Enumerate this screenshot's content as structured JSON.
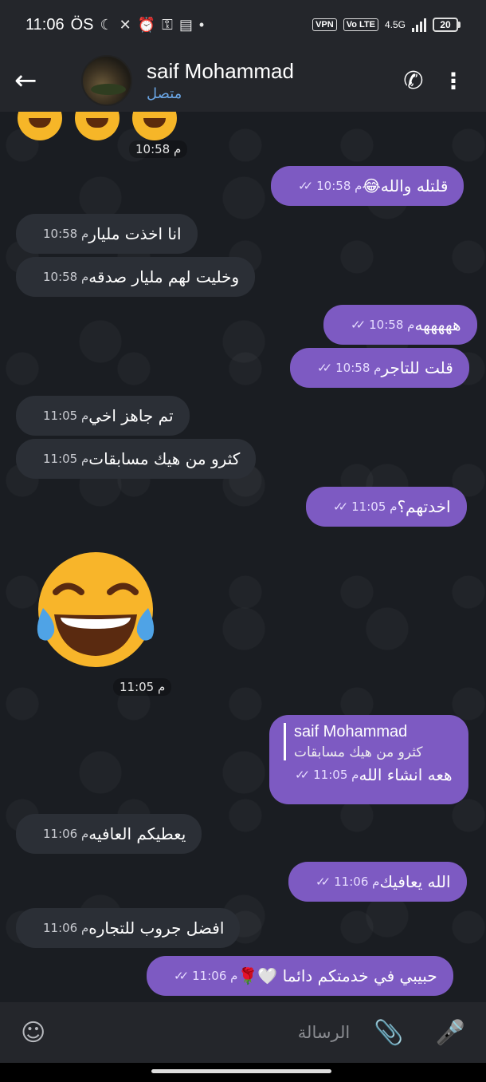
{
  "status": {
    "time": "11:06",
    "carrier": "ÖS",
    "vpn": "VPN",
    "volte": "Vo LTE",
    "network": "4.5G",
    "battery": "20"
  },
  "header": {
    "contact_name": "saif Mohammad",
    "contact_status": "متصل",
    "icons": {
      "back": "arrow-left-icon",
      "call": "phone-icon",
      "menu": "more-vertical-icon"
    }
  },
  "messages": [
    {
      "dir": "time-only",
      "time": "10:58 م"
    },
    {
      "dir": "out",
      "text": "قلتله والله😂",
      "time": "10:58 م"
    },
    {
      "dir": "in",
      "text": "انا اخذت مليار",
      "time": "10:58 م"
    },
    {
      "dir": "in",
      "text": "وخليت لهم مليار صدقه",
      "time": "10:58 م"
    },
    {
      "dir": "out",
      "text": "هههههه",
      "time": "10:58 م"
    },
    {
      "dir": "out",
      "text": "قلت للتاجر",
      "time": "10:58 م"
    },
    {
      "dir": "in",
      "text": "تم جاهز اخي",
      "time": "11:05 م"
    },
    {
      "dir": "in",
      "text": "كثرو من هيك مسابقات",
      "time": "11:05 م"
    },
    {
      "dir": "out",
      "text": "اخدتهم؟",
      "time": "11:05 م"
    },
    {
      "dir": "in-sticker",
      "time": "11:05 م"
    },
    {
      "dir": "out-reply",
      "reply_name": "saif Mohammad",
      "reply_text": "كثرو من هيك مسابقات",
      "text": "هعه انشاء الله",
      "time": "11:05 م"
    },
    {
      "dir": "in",
      "text": "يعطيكم العافيه",
      "time": "11:06 م"
    },
    {
      "dir": "out",
      "text": "الله يعافيك",
      "time": "11:06 م"
    },
    {
      "dir": "in",
      "text": "افضل جروب للتجاره",
      "time": "11:06 م"
    },
    {
      "dir": "out",
      "text": "حبيبي في خدمتكم دائما 🤍🌹",
      "time": "11:06 م"
    }
  ],
  "composer": {
    "placeholder": "الرسالة",
    "icons": {
      "emoji": "smile-icon",
      "attach": "paperclip-icon",
      "mic": "microphone-icon"
    }
  },
  "colors": {
    "bg": "#1a1d22",
    "header": "#24262b",
    "bubble_in": "#2b2f36",
    "bubble_out": "#7d5ac2",
    "status_online": "#6aa5e4"
  }
}
